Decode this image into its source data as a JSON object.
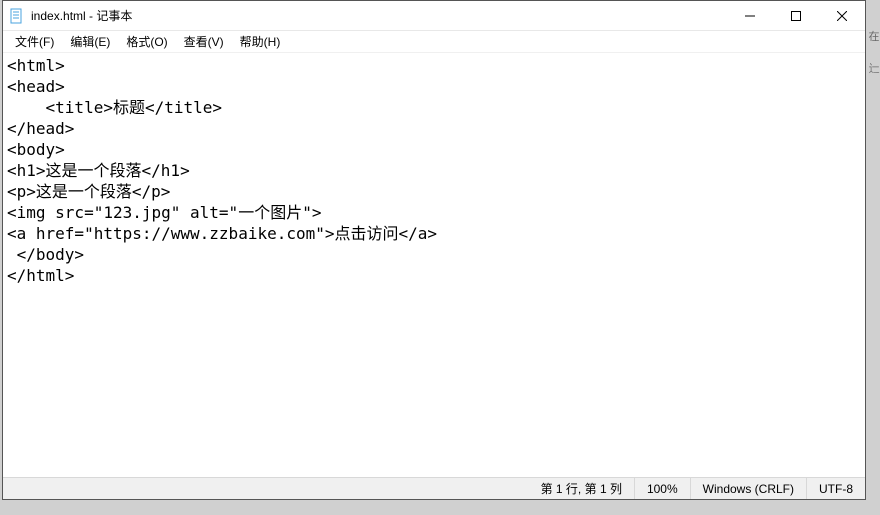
{
  "titlebar": {
    "title": "index.html - 记事本"
  },
  "menu": {
    "file": "文件(F)",
    "edit": "编辑(E)",
    "format": "格式(O)",
    "view": "查看(V)",
    "help": "帮助(H)"
  },
  "editor": {
    "content": "<html>\n<head>\n    <title>标题</title>\n</head>\n<body>\n<h1>这是一个段落</h1>\n<p>这是一个段落</p>\n<img src=\"123.jpg\" alt=\"一个图片\">\n<a href=\"https://www.zzbaike.com\">点击访问</a>\n </body>\n</html>"
  },
  "status": {
    "position": "第 1 行, 第 1 列",
    "zoom": "100%",
    "eol": "Windows (CRLF)",
    "encoding": "UTF-8"
  },
  "edge": {
    "c1": "在",
    "c2": "辷"
  }
}
